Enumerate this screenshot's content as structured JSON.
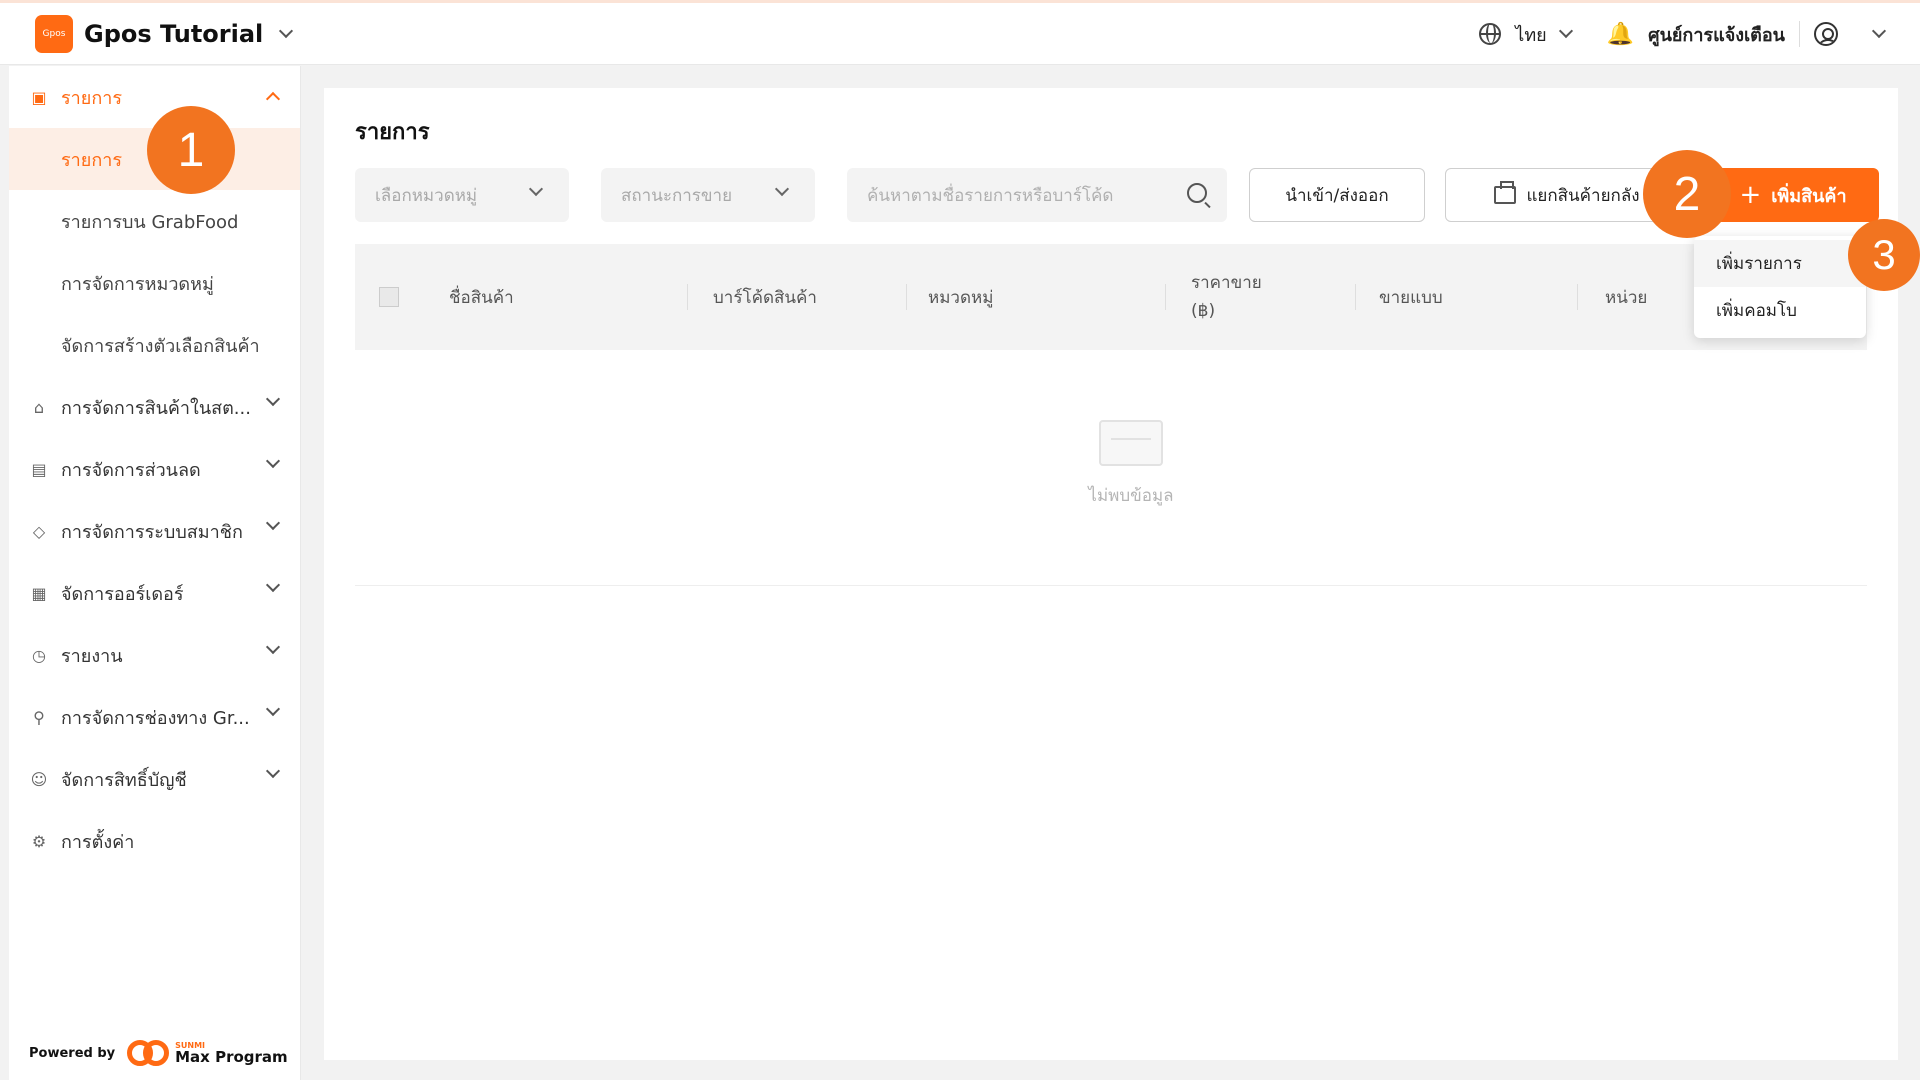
{
  "header": {
    "logo_text": "Gpos",
    "title": "Gpos Tutorial",
    "language": "ไทย",
    "notifications_label": "ศูนย์การแจ้งเตือน"
  },
  "sidebar": {
    "groups": [
      {
        "label": "รายการ",
        "icon": "box-icon",
        "expanded": true,
        "items": [
          "รายการ",
          "รายการบน GrabFood",
          "การจัดการหมวดหมู่",
          "จัดการสร้างตัวเลือกสินค้า"
        ]
      },
      {
        "label": "การจัดการสินค้าในสต...",
        "icon": "store-icon"
      },
      {
        "label": "การจัดการส่วนลด",
        "icon": "discount-icon"
      },
      {
        "label": "การจัดการระบบสมาชิก",
        "icon": "diamond-icon"
      },
      {
        "label": "จัดการออร์เดอร์",
        "icon": "clipboard-icon"
      },
      {
        "label": "รายงาน",
        "icon": "clock-icon"
      },
      {
        "label": "การจัดการช่องทาง Gr...",
        "icon": "network-icon"
      },
      {
        "label": "จัดการสิทธิ์บัญชี",
        "icon": "users-icon"
      },
      {
        "label": "การตั้งค่า",
        "icon": "gear-icon"
      }
    ],
    "powered_by": "Powered by",
    "brand_small": "SUNMI",
    "brand": "Max Program"
  },
  "main": {
    "title": "รายการ",
    "filters": {
      "category_placeholder": "เลือกหมวดหมู่",
      "status_placeholder": "สถานะการขาย",
      "search_placeholder": "ค้นหาตามชื่อรายการหรือบาร์โค้ด"
    },
    "buttons": {
      "import_export": "นำเข้า/ส่งออก",
      "split_stock": "แยกสินค้ายกลัง",
      "add_product": "เพิ่มสินค้า"
    },
    "table": {
      "columns": [
        "ชื่อสินค้า",
        "บาร์โค้ดสินค้า",
        "หมวดหมู่",
        "ราคาขาย",
        "ขายแบบ",
        "หน่วย"
      ],
      "price_unit": "(฿)",
      "empty_text": "ไม่พบข้อมูล"
    },
    "dropdown": [
      "เพิ่มรายการ",
      "เพิ่มคอมโบ"
    ]
  },
  "steps": [
    "1",
    "2",
    "3"
  ],
  "colors": {
    "accent": "#ff6a13",
    "step": "#f27420"
  }
}
